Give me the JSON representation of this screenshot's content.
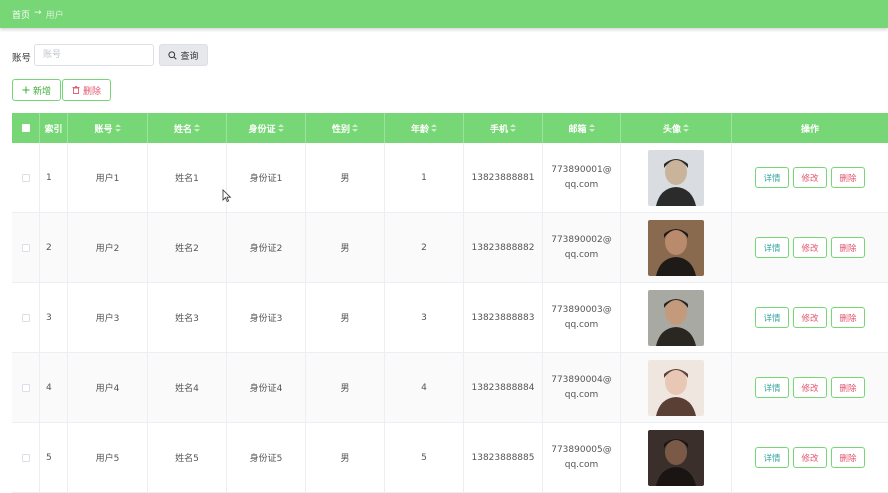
{
  "breadcrumb": {
    "home": "首页",
    "separator": "→",
    "current": "用户"
  },
  "search": {
    "label": "账号",
    "placeholder": "账号",
    "value": "",
    "button_label": "查询"
  },
  "toolbar": {
    "add_label": "新增",
    "delete_label": "删除"
  },
  "table": {
    "columns": [
      "索引",
      "账号",
      "姓名",
      "身份证",
      "性别",
      "年龄",
      "手机",
      "邮箱",
      "头像",
      "操作"
    ],
    "rows": [
      {
        "index": "1",
        "account": "用户1",
        "name": "姓名1",
        "id_card": "身份证1",
        "gender": "男",
        "age": "1",
        "phone": "13823888881",
        "email": "773890001@qq.com",
        "avatar": "person-photo"
      },
      {
        "index": "2",
        "account": "用户2",
        "name": "姓名2",
        "id_card": "身份证2",
        "gender": "男",
        "age": "2",
        "phone": "13823888882",
        "email": "773890002@qq.com",
        "avatar": "person-photo"
      },
      {
        "index": "3",
        "account": "用户3",
        "name": "姓名3",
        "id_card": "身份证3",
        "gender": "男",
        "age": "3",
        "phone": "13823888883",
        "email": "773890003@qq.com",
        "avatar": "person-photo"
      },
      {
        "index": "4",
        "account": "用户4",
        "name": "姓名4",
        "id_card": "身份证4",
        "gender": "男",
        "age": "4",
        "phone": "13823888884",
        "email": "773890004@qq.com",
        "avatar": "person-photo"
      },
      {
        "index": "5",
        "account": "用户5",
        "name": "姓名5",
        "id_card": "身份证5",
        "gender": "男",
        "age": "5",
        "phone": "13823888885",
        "email": "773890005@qq.com",
        "avatar": "person-photo"
      }
    ],
    "actions": {
      "detail": "详情",
      "edit": "修改",
      "delete": "删除"
    }
  },
  "colors": {
    "accent": "#77d675",
    "danger": "#e0566d",
    "info": "#3aa6a0"
  }
}
